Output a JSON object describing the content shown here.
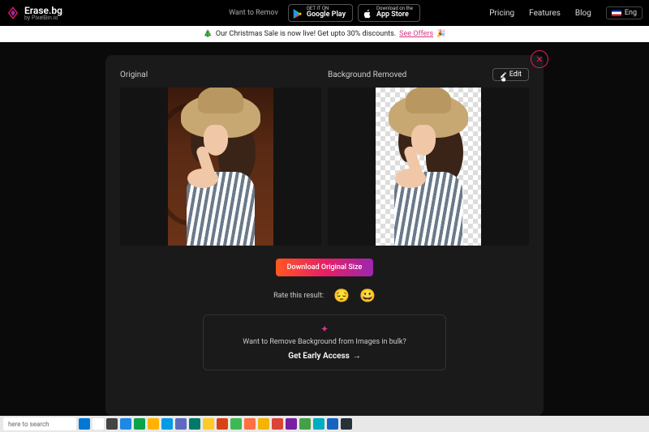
{
  "brand": {
    "name": "Erase.bg",
    "sub": "by PixelBin.io"
  },
  "header": {
    "tagline": "Want to Remov",
    "google_play": {
      "mini": "GET IT ON",
      "main": "Google Play"
    },
    "app_store": {
      "mini": "Download on the",
      "main": "App Store"
    },
    "nav": {
      "pricing": "Pricing",
      "features": "Features",
      "blog": "Blog"
    },
    "lang": "Eng"
  },
  "sale": {
    "emoji_left": "🎄",
    "text": "Our Christmas Sale is now live! Get upto 30% discounts.",
    "link": "See Offers",
    "emoji_right": "🎉"
  },
  "panel": {
    "original_label": "Original",
    "removed_label": "Background Removed",
    "edit_label": "Edit",
    "download_label": "Download Original Size",
    "rate_label": "Rate this result:",
    "emoji_sad": "😔",
    "emoji_happy": "😀"
  },
  "bulk": {
    "question": "Want to Remove Background from Images in bulk?",
    "cta": "Get Early Access",
    "arrow": "→"
  },
  "taskbar": {
    "search_hint": "here to search",
    "icons": [
      "#0078d4",
      "#ffffff",
      "#444444",
      "#1e88e5",
      "#0aa34a",
      "#ffb300",
      "#039be5",
      "#5c6bc0",
      "#00796b",
      "#ffca28",
      "#d84315",
      "#3cba54",
      "#ff7043",
      "#f4b400",
      "#db4437",
      "#7b1fa2",
      "#43a047",
      "#00acc1",
      "#1565c0",
      "#263238"
    ]
  }
}
